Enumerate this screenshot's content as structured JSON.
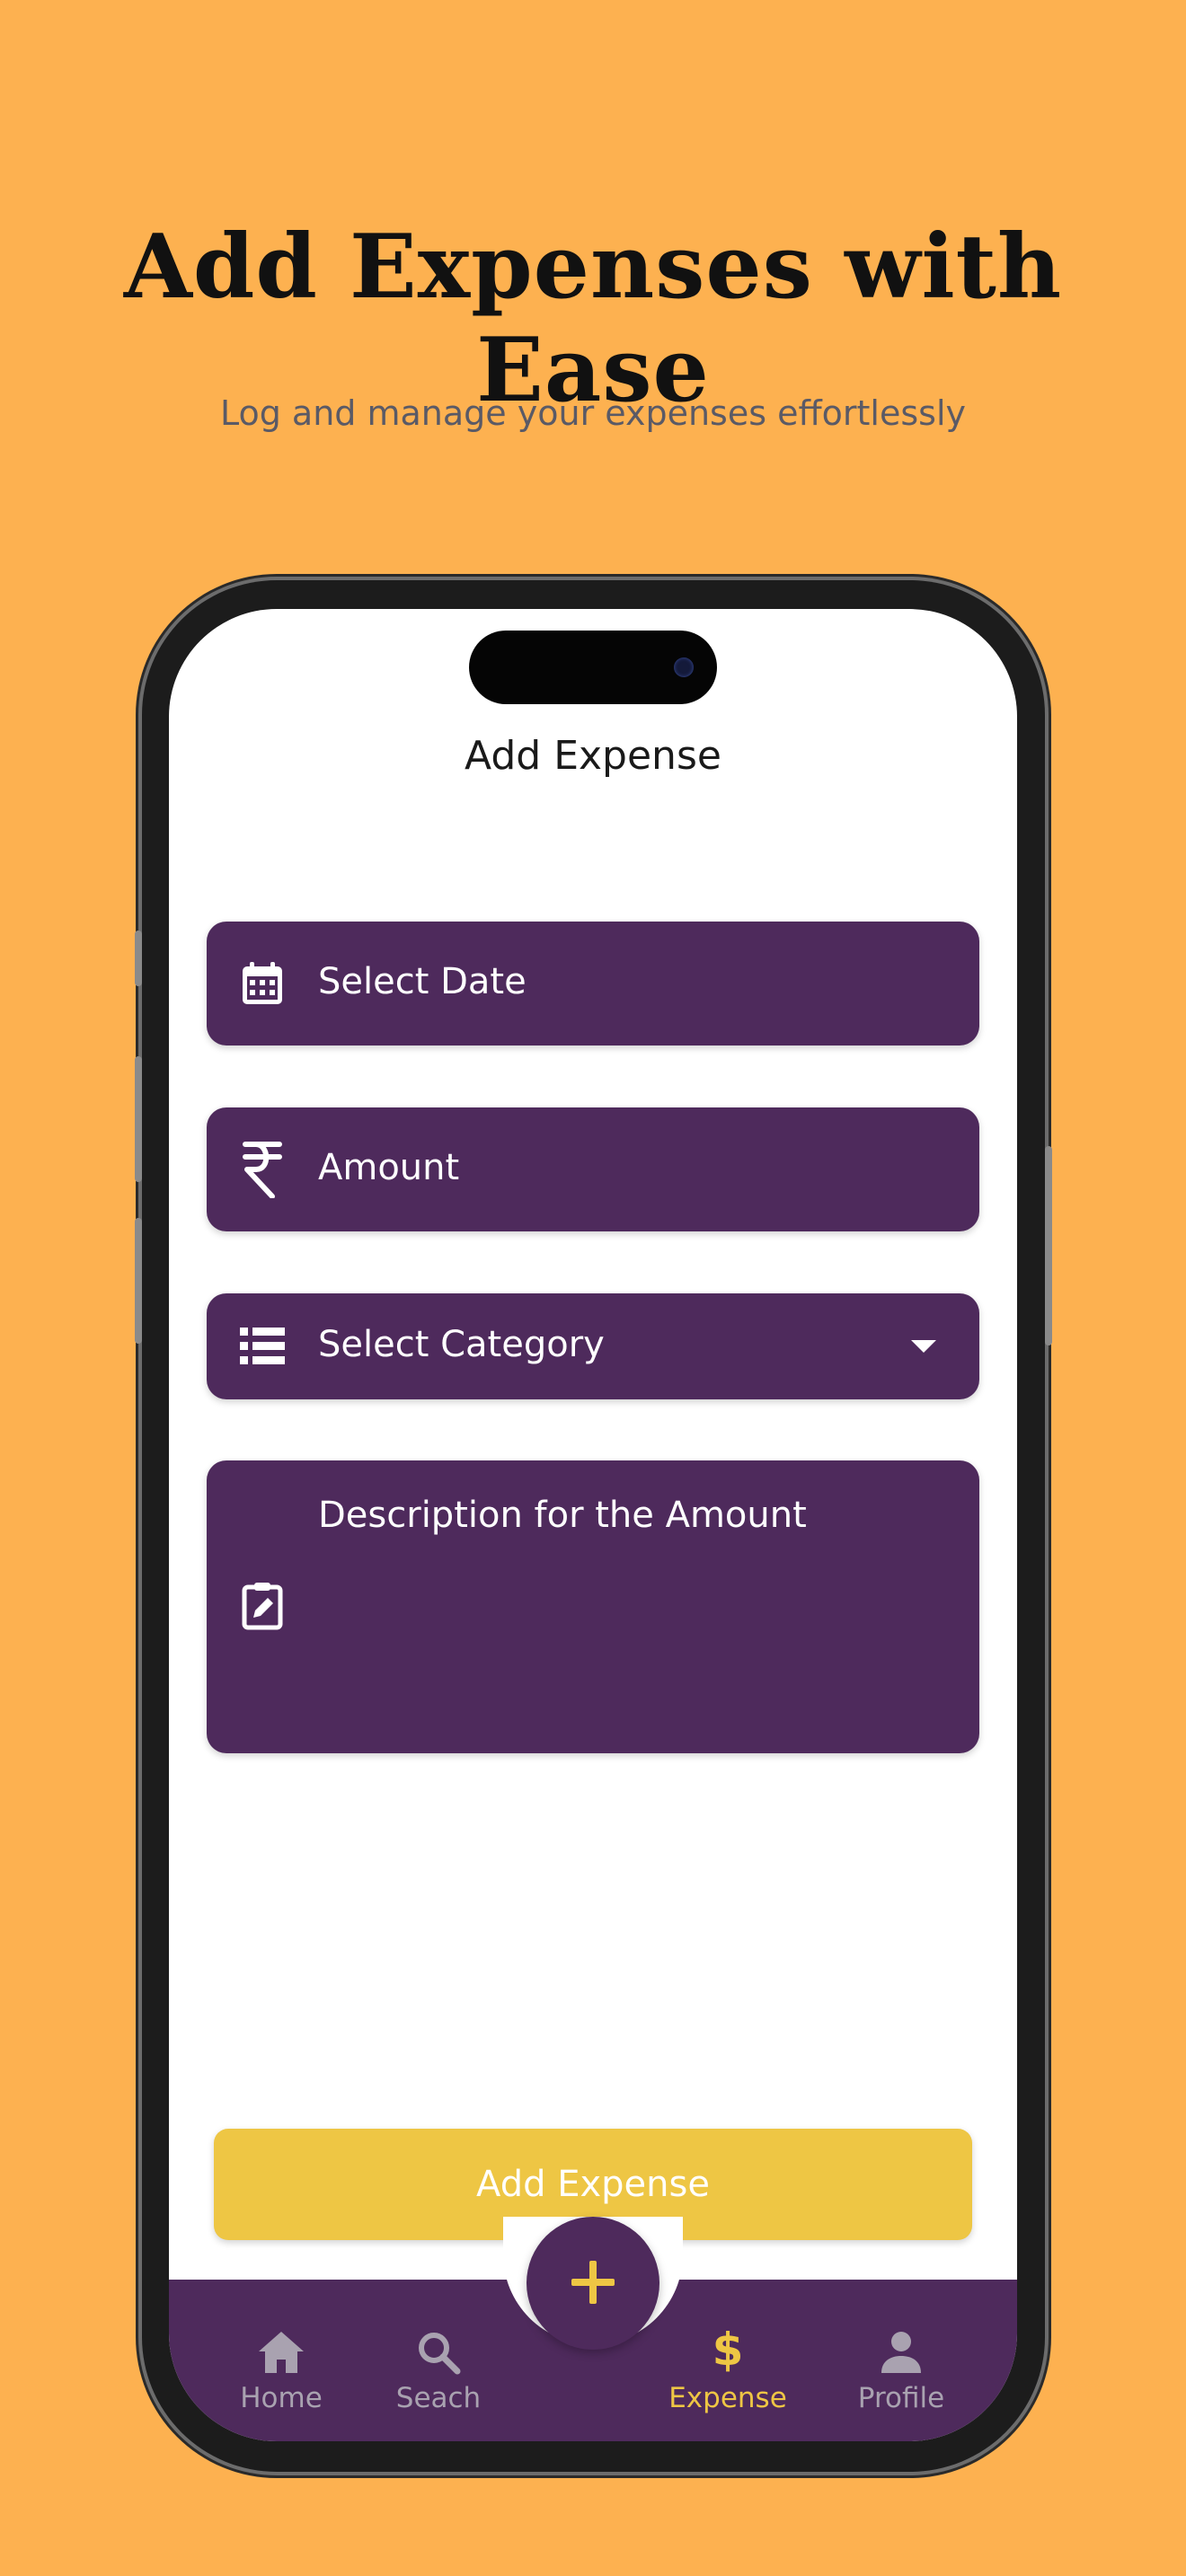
{
  "headline": "Add Expenses with Ease",
  "subheadline": "Log and manage your expenses effortlessly",
  "screen": {
    "title": "Add Expense",
    "fields": {
      "date": {
        "label": "Select Date",
        "icon": "calendar-icon"
      },
      "amount": {
        "label": "Amount",
        "icon": "rupee-icon"
      },
      "category": {
        "label": "Select Category",
        "icon": "list-icon"
      },
      "description": {
        "label": "Description for the Amount",
        "icon": "edit-note-icon"
      }
    },
    "submit_label": "Add Expense",
    "fab_icon": "plus-icon"
  },
  "nav": {
    "items": [
      {
        "label": "Home",
        "icon": "home-icon"
      },
      {
        "label": "Seach",
        "icon": "search-icon"
      },
      {
        "label": "Expense",
        "icon": "dollar-icon",
        "active": true
      },
      {
        "label": "Profile",
        "icon": "person-icon"
      }
    ]
  },
  "colors": {
    "background": "#FDB150",
    "primary": "#4E2A5C",
    "accent": "#EEC644",
    "inactive_nav": "#A9A2B0"
  }
}
